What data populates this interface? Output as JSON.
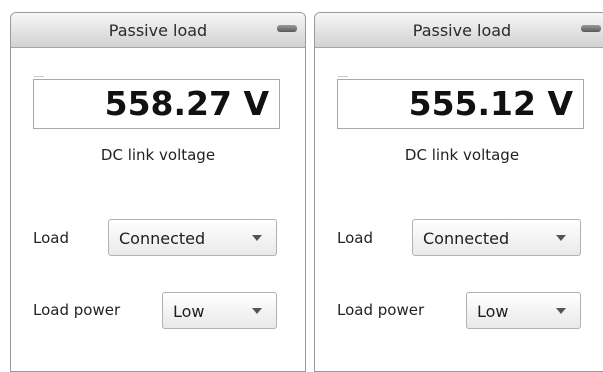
{
  "panels": [
    {
      "title": "Passive load",
      "voltage": "558.27 V",
      "voltage_caption": "DC link voltage",
      "load_label": "Load",
      "load_value": "Connected",
      "power_label": "Load power",
      "power_value": "Low"
    },
    {
      "title": "Passive load",
      "voltage": "555.12 V",
      "voltage_caption": "DC link voltage",
      "load_label": "Load",
      "load_value": "Connected",
      "power_label": "Load power",
      "power_value": "Low"
    }
  ],
  "icons": {
    "minimize": "minimize-icon",
    "dropdown": "chevron-down-icon"
  },
  "colors": {
    "panel_border": "#9a9a9a",
    "header_top": "#f7f7f7",
    "header_bottom": "#d2d2d2",
    "value_text": "#111111"
  }
}
